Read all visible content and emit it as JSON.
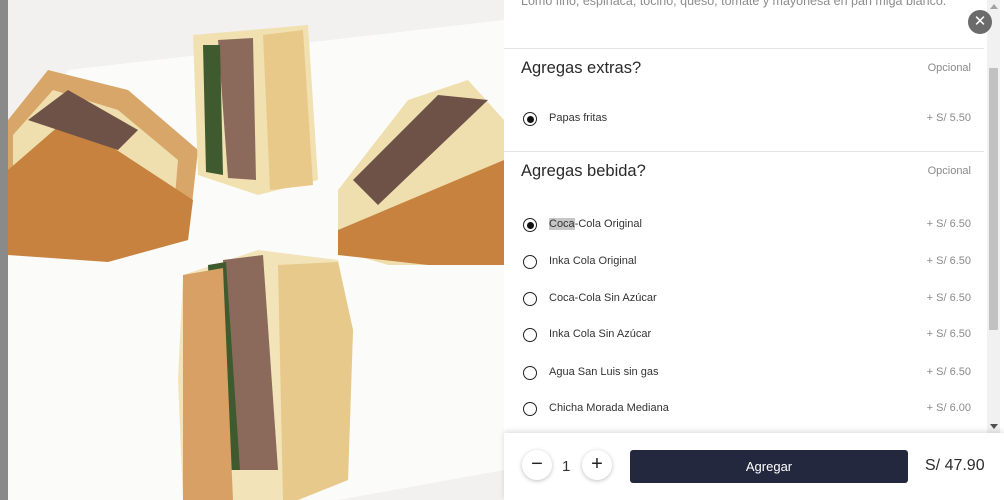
{
  "product": {
    "description": "Lomo fino, espinaca, tocino, queso, tomate y mayonesa en pan miga blanco."
  },
  "sections": [
    {
      "title": "Agregas extras?",
      "tag": "Opcional",
      "options": [
        {
          "label": "Papas fritas",
          "price": "+ S/ 5.50",
          "checked": true
        }
      ]
    },
    {
      "title": "Agregas bebida?",
      "tag": "Opcional",
      "options": [
        {
          "label_highlight": "Coca",
          "label_rest": "-Cola Original",
          "price": "+ S/ 6.50",
          "checked": true
        },
        {
          "label": "Inka Cola Original",
          "price": "+ S/ 6.50",
          "checked": false
        },
        {
          "label": "Coca-Cola Sin Azúcar",
          "price": "+ S/ 6.50",
          "checked": false
        },
        {
          "label": "Inka Cola Sin Azúcar",
          "price": "+ S/ 6.50",
          "checked": false
        },
        {
          "label": "Agua San Luis sin gas",
          "price": "+ S/ 6.50",
          "checked": false
        },
        {
          "label": "Chicha Morada Mediana",
          "price": "+ S/ 6.00",
          "checked": false
        }
      ]
    }
  ],
  "footer": {
    "minus_icon": "−",
    "quantity": "1",
    "plus_icon": "+",
    "add_label": "Agregar",
    "total": "S/ 47.90"
  },
  "icons": {
    "close": "✕"
  }
}
